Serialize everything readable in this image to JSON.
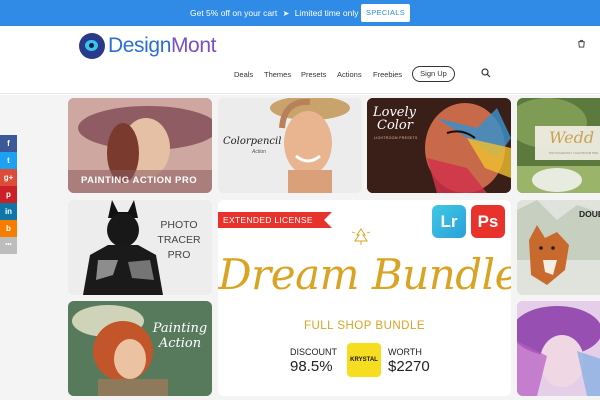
{
  "promo": {
    "text_before": "Get 5% off on your cart",
    "text_after": "Limited time only",
    "button": "SPECIALS"
  },
  "header": {
    "logo": {
      "part1": "Design",
      "part2": "Mont"
    },
    "nav": [
      "Deals",
      "Themes",
      "Presets",
      "Actions",
      "Freebies"
    ],
    "signup": "Sign Up"
  },
  "tiles": {
    "painting_action_pro": "PAINTING ACTION PRO",
    "colorpencil": {
      "title": "Colorpencil",
      "sub": "Action"
    },
    "lovely_color": {
      "l1": "Lovely",
      "l2": "Color",
      "sub": "LIGHTROOM PRESETS"
    },
    "wedding": {
      "title": "Wedd",
      "sub": "PHOTOGRAPHY LIGHTROOM PRE"
    },
    "photo_tracer": {
      "l1": "PHOTO",
      "l2": "TRACER",
      "l3": "PRO"
    },
    "dream_bundle": {
      "ribbon": "EXTENDED LICENSE",
      "badge_lr": "Lr",
      "badge_ps": "Ps",
      "title": "Dream Bundle",
      "subtitle": "FULL SHOP BUNDLE",
      "discount_label": "DISCOUNT",
      "discount_value": "98.5%",
      "brand": "KRYSTAL",
      "worth_label": "WORTH",
      "worth_value": "$2270"
    },
    "double": {
      "title": "DOUB"
    },
    "painting_action": {
      "l1": "Painting",
      "l2": "Action"
    }
  },
  "social": [
    "f",
    "t",
    "g+",
    "p",
    "in",
    "b",
    "•••"
  ],
  "colors": {
    "promo_bg": "#2f8be6",
    "accent_red": "#e8332d",
    "gold": "#d9a423",
    "krystal_yellow": "#f7dd20"
  }
}
